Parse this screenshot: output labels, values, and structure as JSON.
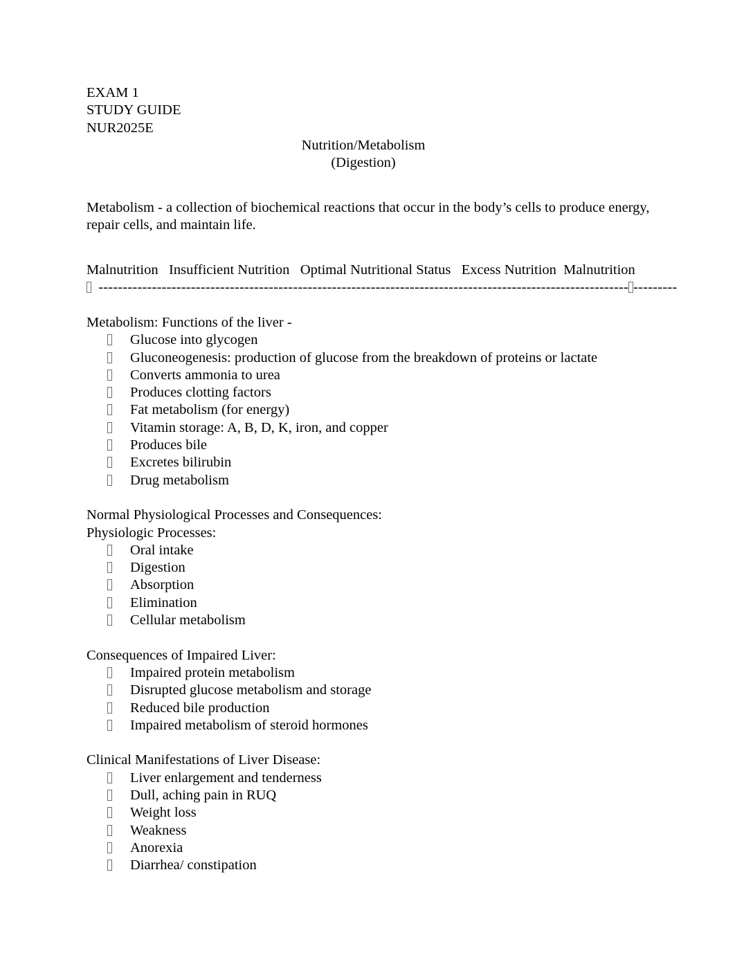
{
  "document": {
    "header_lines": [
      "EXAM 1",
      "STUDY GUIDE",
      "NUR2025E"
    ],
    "title": "Nutrition/Metabolism",
    "subtitle": "(Digestion)",
    "definition_paragraph": "Metabolism - a collection of biochemical reactions that occur in the body’s cells to produce energy, repair cells, and maintain life.",
    "nutrition_scale": {
      "labels": [
        "Malnutrition",
        "Insufficient Nutrition",
        "Optimal Nutritional Status",
        "Excess Nutrition",
        "Malnutrition"
      ],
      "left_marker": "□",
      "mid_marker": "□",
      "dash_segment_left": "-------------------------------------------------------------------------------------------------------------",
      "dash_segment_right": "---------"
    },
    "sections": [
      {
        "heading": "Metabolism: Functions of the liver -",
        "items": [
          "Glucose into glycogen",
          "Gluconeogenesis: production of glucose from the breakdown of proteins or lactate",
          "Converts ammonia to urea",
          "Produces clotting factors",
          "Fat metabolism (for energy)",
          "Vitamin storage: A, B, D, K, iron, and copper",
          "Produces bile",
          "Excretes bilirubin",
          "Drug metabolism"
        ]
      },
      {
        "heading": "Normal Physiological Processes and Consequences:",
        "subheading": "Physiologic Processes:",
        "items": [
          "Oral intake",
          "Digestion",
          "Absorption",
          "Elimination",
          "Cellular metabolism"
        ]
      },
      {
        "heading": "Consequences of Impaired Liver:",
        "items": [
          "Impaired protein metabolism",
          "Disrupted glucose metabolism and storage",
          "Reduced bile production",
          "Impaired metabolism of steroid hormones"
        ]
      },
      {
        "heading": "Clinical Manifestations of Liver Disease:",
        "items": [
          "Liver enlargement and tenderness",
          "Dull, aching pain in RUQ",
          "Weight loss",
          "Weakness",
          "Anorexia",
          "Diarrhea/ constipation"
        ]
      }
    ]
  }
}
